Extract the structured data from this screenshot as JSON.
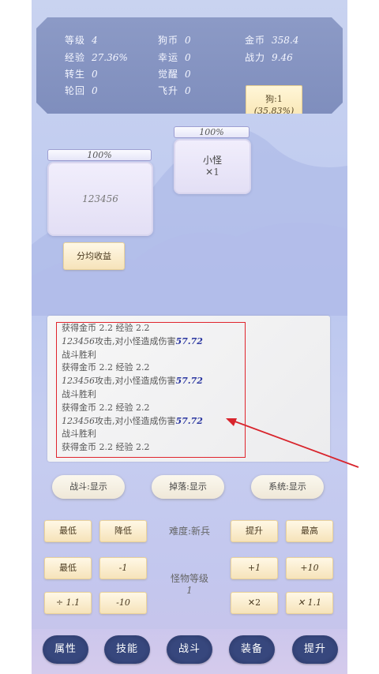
{
  "stats": {
    "level": {
      "label": "等级",
      "value": "4"
    },
    "exp": {
      "label": "经验",
      "value": "27.36%"
    },
    "rebirth": {
      "label": "转生",
      "value": "0"
    },
    "cycle": {
      "label": "轮回",
      "value": "0"
    },
    "dogcoin": {
      "label": "狗币",
      "value": "0"
    },
    "luck": {
      "label": "幸运",
      "value": "0"
    },
    "awaken": {
      "label": "觉醒",
      "value": "0"
    },
    "ascend": {
      "label": "飞升",
      "value": "0"
    },
    "gold": {
      "label": "金币",
      "value": "358.4"
    },
    "power": {
      "label": "战力",
      "value": "9.46"
    }
  },
  "dog_box": {
    "line1": "狗:1",
    "line2": "(35.83%)"
  },
  "player": {
    "hp": "100%",
    "name": "123456"
  },
  "monster": {
    "hp": "100%",
    "name": "小怪",
    "count": "✕1"
  },
  "split_button": "分均收益",
  "log": [
    {
      "type": "reward",
      "text": "获得金币 2.2 经验 2.2"
    },
    {
      "type": "attack",
      "attacker": "123456",
      "mid": "攻击,对小怪造成伤害",
      "dmg": "57.72"
    },
    {
      "type": "plain",
      "text": "战斗胜利"
    },
    {
      "type": "reward",
      "text": "获得金币 2.2 经验 2.2"
    },
    {
      "type": "attack",
      "attacker": "123456",
      "mid": "攻击,对小怪造成伤害",
      "dmg": "57.72"
    },
    {
      "type": "plain",
      "text": "战斗胜利"
    },
    {
      "type": "reward",
      "text": "获得金币 2.2 经验 2.2"
    },
    {
      "type": "attack",
      "attacker": "123456",
      "mid": "攻击,对小怪造成伤害",
      "dmg": "57.72"
    },
    {
      "type": "plain",
      "text": "战斗胜利"
    },
    {
      "type": "reward",
      "text": "获得金币 2.2 经验 2.2"
    }
  ],
  "toggles": {
    "battle": "战斗:显示",
    "drop": "掉落:显示",
    "system": "系统:显示"
  },
  "difficulty": {
    "label": "难度:新兵",
    "lowest": "最低",
    "lower": "降低",
    "raise": "提升",
    "highest": "最高"
  },
  "monster_level": {
    "label": "怪物等级",
    "value": "1",
    "min": "最低",
    "minus1": "-1",
    "div": "÷ 1.1",
    "minus10": "-10",
    "plus1": "+1",
    "plus10": "+10",
    "times2": "✕2",
    "times11": "✕ 1.1"
  },
  "nav": [
    "属性",
    "技能",
    "战斗",
    "装备",
    "提升"
  ],
  "colors": {
    "highlight_box": "#e0242c",
    "arrow": "#d8242c",
    "damage": "#2a36a0",
    "nav_bg": "#37477d"
  }
}
